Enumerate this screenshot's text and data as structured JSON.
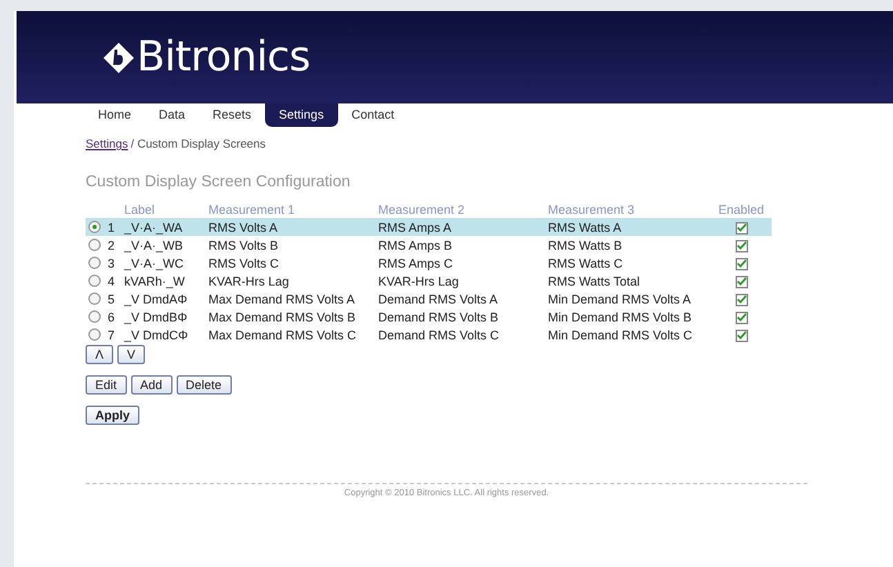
{
  "logo": {
    "text": "Bitronics"
  },
  "nav": [
    {
      "label": "Home",
      "selected": false
    },
    {
      "label": "Data",
      "selected": false
    },
    {
      "label": "Resets",
      "selected": false
    },
    {
      "label": "Settings",
      "selected": true
    },
    {
      "label": "Contact",
      "selected": false
    }
  ],
  "breadcrumb": {
    "link": "Settings",
    "current": "/ Custom Display Screens"
  },
  "title": "Custom Display Screen Configuration",
  "table": {
    "columns": [
      "Label",
      "Measurement 1",
      "Measurement 2",
      "Measurement 3",
      "Enabled"
    ],
    "rows": [
      {
        "selected": true,
        "number": "1",
        "label": "_V·A·_WA",
        "m1": "RMS Volts A",
        "m2": "RMS Amps A",
        "m3": "RMS Watts A",
        "enabled": true
      },
      {
        "selected": false,
        "number": "2",
        "label": "_V·A·_WB",
        "m1": "RMS Volts B",
        "m2": "RMS Amps B",
        "m3": "RMS Watts B",
        "enabled": true
      },
      {
        "selected": false,
        "number": "3",
        "label": "_V·A·_WC",
        "m1": "RMS Volts C",
        "m2": "RMS Amps C",
        "m3": "RMS Watts C",
        "enabled": true
      },
      {
        "selected": false,
        "number": "4",
        "label": "kVARh·_W",
        "m1": "KVAR-Hrs Lag",
        "m2": "KVAR-Hrs Lag",
        "m3": "RMS Watts Total",
        "enabled": true
      },
      {
        "selected": false,
        "number": "5",
        "label": "_V DmdAΦ",
        "m1": "Max Demand RMS Volts A",
        "m2": "Demand RMS Volts A",
        "m3": "Min Demand RMS Volts A",
        "enabled": true
      },
      {
        "selected": false,
        "number": "6",
        "label": "_V DmdBΦ",
        "m1": "Max Demand RMS Volts B",
        "m2": "Demand RMS Volts B",
        "m3": "Min Demand RMS Volts B",
        "enabled": true
      },
      {
        "selected": false,
        "number": "7",
        "label": "_V DmdCΦ",
        "m1": "Max Demand RMS Volts C",
        "m2": "Demand RMS Volts C",
        "m3": "Min Demand RMS Volts C",
        "enabled": true
      }
    ]
  },
  "move_buttons": [
    "Λ",
    "V"
  ],
  "edit_buttons": [
    "Edit",
    "Add",
    "Delete"
  ],
  "apply_button": "Apply",
  "footer": "Copyright © 2010 Bitronics LLC. All rights reserved."
}
